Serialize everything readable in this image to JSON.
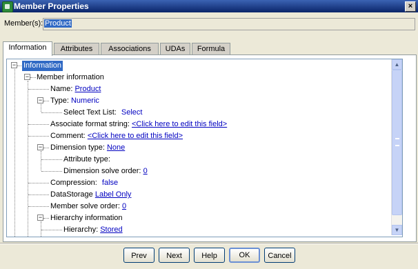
{
  "window": {
    "title": "Member Properties",
    "close_glyph": "×"
  },
  "members": {
    "label": "Member(s):",
    "value": "Product"
  },
  "tabs": [
    {
      "label": "Information",
      "active": true
    },
    {
      "label": "Attributes",
      "active": false
    },
    {
      "label": "Associations",
      "active": false
    },
    {
      "label": "UDAs",
      "active": false
    },
    {
      "label": "Formula",
      "active": false
    }
  ],
  "tree": {
    "root": "Information",
    "member_information": "Member information",
    "name": {
      "label": "Name:",
      "value": "Product"
    },
    "type": {
      "label": "Type:",
      "value": "Numeric"
    },
    "select_text_list": {
      "label": "Select Text List:",
      "value": "Select"
    },
    "associate_format": {
      "label": "Associate format string:",
      "value": "<Click here to edit this field>"
    },
    "comment": {
      "label": "Comment:",
      "value": "<Click here to edit this field>"
    },
    "dimension_type": {
      "label": "Dimension type:",
      "value": "None"
    },
    "attribute_type": {
      "label": "Attribute type:"
    },
    "dimension_solve_order": {
      "label": "Dimension solve order:",
      "value": "0"
    },
    "compression": {
      "label": "Compression:",
      "value": "false"
    },
    "datastorage": {
      "label": "DataStorage",
      "value": "Label Only"
    },
    "member_solve_order": {
      "label": "Member solve order:",
      "value": "0"
    },
    "hierarchy_information": "Hierarchy information",
    "hierarchy": {
      "label": "Hierarchy:",
      "value": "Stored"
    },
    "expand_glyph": "−"
  },
  "buttons": {
    "prev": "Prev",
    "next": "Next",
    "help": "Help",
    "ok": "OK",
    "cancel": "Cancel"
  },
  "colors": {
    "accent": "#0a246a",
    "selection": "#316ac5",
    "link": "#0000c0"
  },
  "icons": [
    "app-icon",
    "close-icon",
    "collapse-icon",
    "scroll-up-icon",
    "scroll-down-icon"
  ]
}
